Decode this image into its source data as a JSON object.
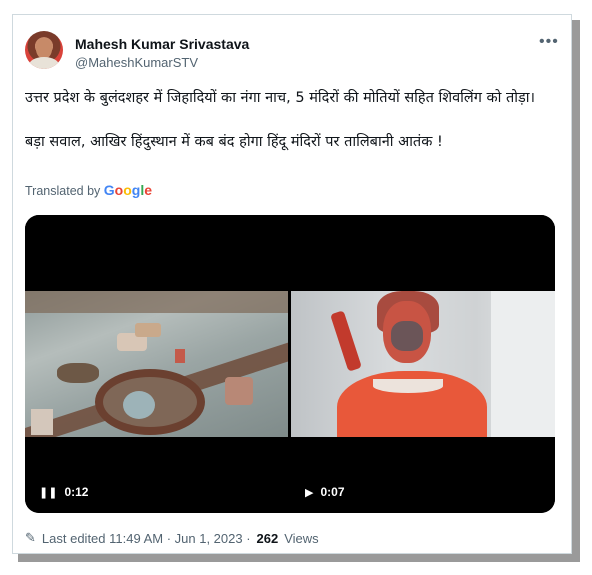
{
  "user": {
    "name": "Mahesh Kumar Srivastava",
    "handle": "@MaheshKumarSTV"
  },
  "more_icon": "more-horizontal-icon",
  "tweet": {
    "line1": "उत्तर प्रदेश के बुलंदशहर में जिहादियों का नंगा नाच, 5 मंदिरों की मोतियों सहित शिवलिंग को तोड़ा।",
    "line2": "बड़ा सवाल, आखिर हिंदुस्थान में कब बंद होगा हिंदू मंदिरों पर तालिबानी आतंक !"
  },
  "translation": {
    "label": "Translated by",
    "brand": [
      "G",
      "o",
      "o",
      "g",
      "l",
      "e"
    ]
  },
  "videos": [
    {
      "state_icon": "pause-icon",
      "time": "0:12"
    },
    {
      "state_icon": "play-icon",
      "time": "0:07"
    }
  ],
  "footer": {
    "edit_icon": "pencil-icon",
    "edited": "Last edited 11:49 AM · Jun 1, 2023 ·",
    "views_count": "262",
    "views_label": "Views"
  }
}
